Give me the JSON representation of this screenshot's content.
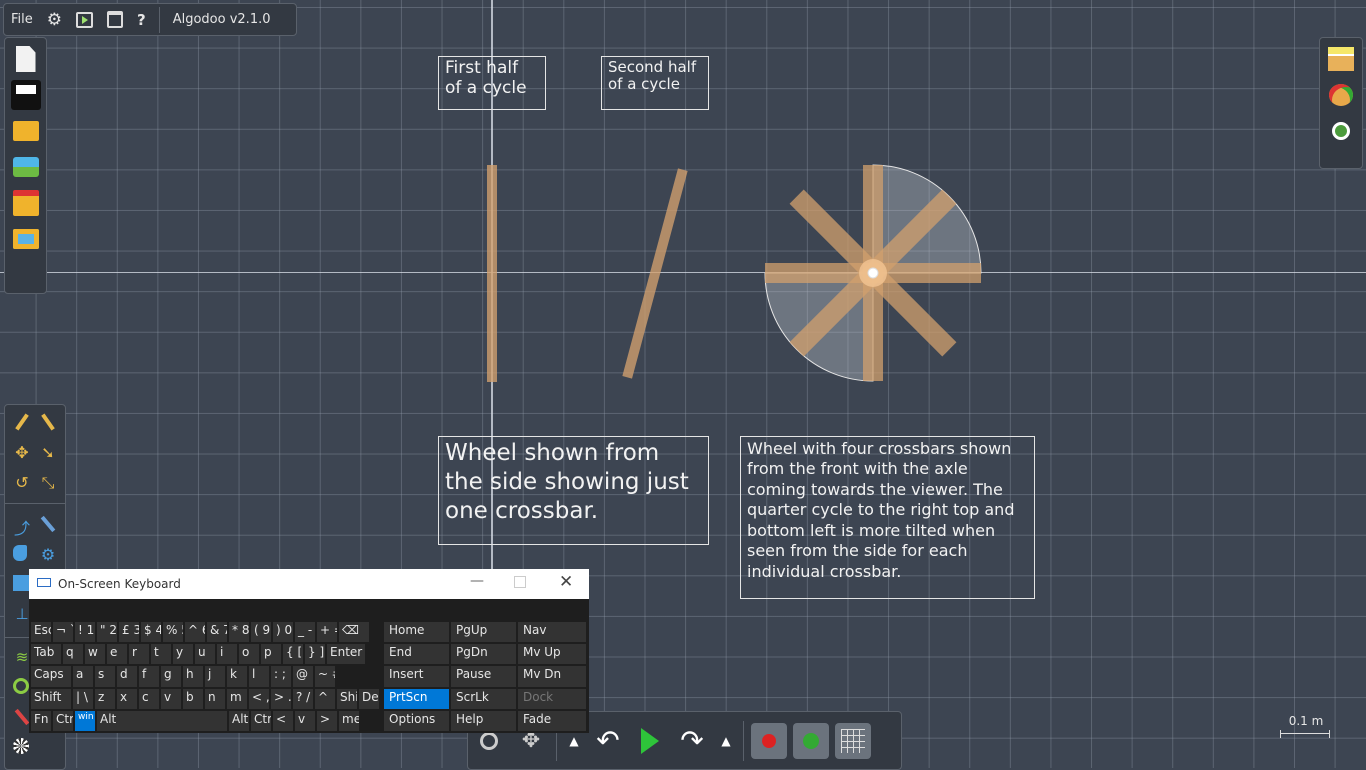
{
  "app": {
    "title": "Algodoo v2.1.0",
    "menu_file": "File",
    "menu_help": "?"
  },
  "canvas": {
    "label_first_half": "First half of a cycle",
    "label_second_half": "Second half of a cycle",
    "label_side": "Wheel shown from the side showing just one crossbar.",
    "label_front": "Wheel with four crossbars shown from the front with the axle coming towards the viewer. The quarter cycle to the right top and bottom left is more tilted when seen from the side for each individual crossbar.",
    "scale_label": "0.1 m"
  },
  "left_toolbar": [
    "new-scene-icon",
    "scene-panel-icon",
    "open-folder-icon",
    "web-scenes-icon",
    "phunlets-icon",
    "images-folder-icon"
  ],
  "tools": [
    "sketch-icon",
    "cut-icon",
    "move-icon",
    "drag-icon",
    "rotate-icon",
    "scale-icon",
    "rope-icon",
    "knife-icon",
    "brush-icon",
    "gear-icon",
    "box-icon",
    "plane-icon",
    "spring-icon",
    "circle-icon",
    "pen-icon",
    "wheel-icon"
  ],
  "right_toolbar": [
    "background-icon",
    "palette-icon",
    "zoom-icon"
  ],
  "osk": {
    "title": "On-Screen Keyboard",
    "rows": [
      [
        "Esc",
        "¬ `",
        "! 1",
        "\" 2",
        "£ 3",
        "$ 4",
        "% 5",
        "^ 6",
        "& 7",
        "* 8",
        "( 9",
        ") 0",
        "_ -",
        "+ =",
        "⌫"
      ],
      [
        "Tab",
        "q",
        "w",
        "e",
        "r",
        "t",
        "y",
        "u",
        "i",
        "o",
        "p",
        "{ [",
        "} ]",
        "Enter"
      ],
      [
        "Caps",
        "a",
        "s",
        "d",
        "f",
        "g",
        "h",
        "j",
        "k",
        "l",
        ": ;",
        "@ '",
        "~ #"
      ],
      [
        "Shift",
        "| \\",
        "z",
        "x",
        "c",
        "v",
        "b",
        "n",
        "m",
        "< ,",
        "> .",
        "? /",
        "^",
        "Shi",
        "Del"
      ],
      [
        "Fn",
        "Ctr",
        "win",
        "Alt",
        "Alt",
        "Ctr",
        "<",
        "v",
        ">",
        "menu"
      ]
    ],
    "nav_keys": [
      [
        "Home",
        "PgUp",
        "Nav"
      ],
      [
        "End",
        "PgDn",
        "Mv Up"
      ],
      [
        "Insert",
        "Pause",
        "Mv Dn"
      ],
      [
        "PrtScn",
        "ScrLk",
        "Dock"
      ],
      [
        "Options",
        "Help",
        "Fade"
      ]
    ]
  },
  "bottom_toolbar": [
    "zoom-tool-icon",
    "pan-tool-icon",
    "up-arrow-icon",
    "undo-icon",
    "play-icon",
    "redo-icon",
    "up-arrow-icon",
    "gravity-icon",
    "air-friction-icon",
    "grid-icon"
  ],
  "colors": {
    "background": "#3d4552",
    "accent": "#0078d7",
    "wood": "#d2a06e"
  }
}
